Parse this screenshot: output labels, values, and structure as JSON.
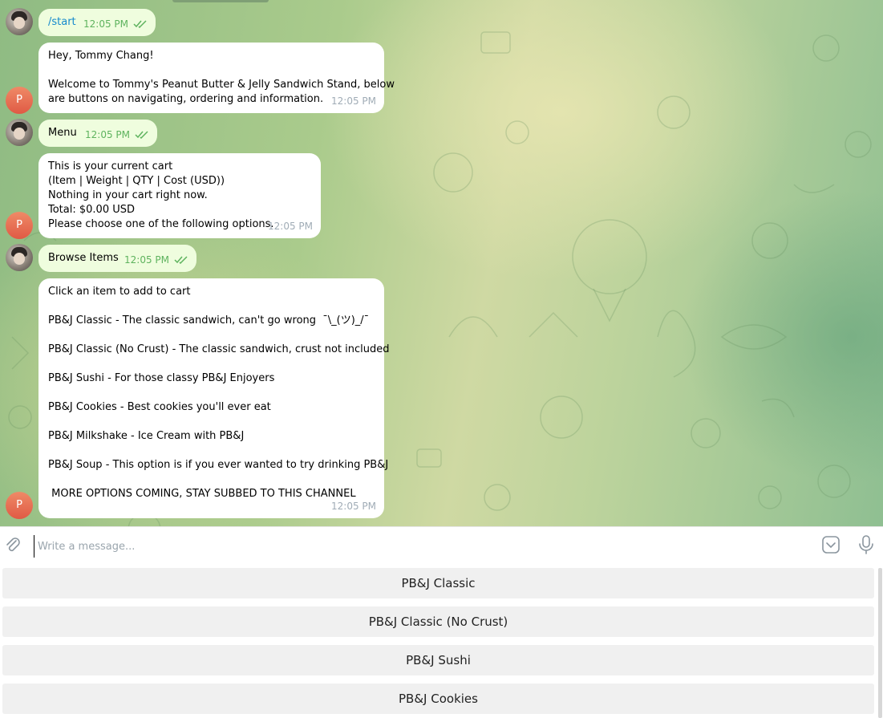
{
  "messages": [
    {
      "type": "out",
      "text": "/start",
      "time": "12:05 PM"
    },
    {
      "type": "in",
      "avatar": "P",
      "text": "Hey, Tommy Chang!\n\nWelcome to Tommy's Peanut Butter & Jelly Sandwich Stand, below\nare buttons on navigating, ordering and information.",
      "time": "12:05 PM"
    },
    {
      "type": "out",
      "text": "Menu",
      "time": "12:05 PM"
    },
    {
      "type": "in",
      "avatar": "P",
      "text": "This is your current cart\n(Item | Weight | QTY | Cost (USD))\nNothing in your cart right now.\nTotal: $0.00 USD\nPlease choose one of the following options.",
      "time": "12:05 PM"
    },
    {
      "type": "out",
      "text": "Browse Items",
      "time": "12:05 PM"
    },
    {
      "type": "in",
      "avatar": "P",
      "text": "Click an item to add to cart\n\nPB&J Classic - The classic sandwich, can't go wrong  ¯\\_(ツ)_/¯\n\nPB&J Classic (No Crust) - The classic sandwich, crust not included\n\nPB&J Sushi - For those classy PB&J Enjoyers\n\nPB&J Cookies - Best cookies you'll ever eat\n\nPB&J Milkshake - Ice Cream with PB&J\n\nPB&J Soup - This option is if you ever wanted to try drinking PB&J\n\n MORE OPTIONS COMING, STAY SUBBED TO THIS CHANNEL",
      "time": "12:05 PM"
    }
  ],
  "compose": {
    "placeholder": "Write a message...",
    "attach_icon": "paperclip-icon",
    "emoji_icon": "emoji-icon",
    "mic_icon": "microphone-icon"
  },
  "keyboard": {
    "buttons": [
      "PB&J Classic",
      "PB&J Classic (No Crust)",
      "PB&J Sushi",
      "PB&J Cookies"
    ]
  },
  "colors": {
    "outgoing_bubble": "#effdde",
    "incoming_bubble": "#ffffff",
    "check_green": "#5eb35e",
    "command_blue": "#168acd",
    "bot_avatar": "#e05a45"
  }
}
